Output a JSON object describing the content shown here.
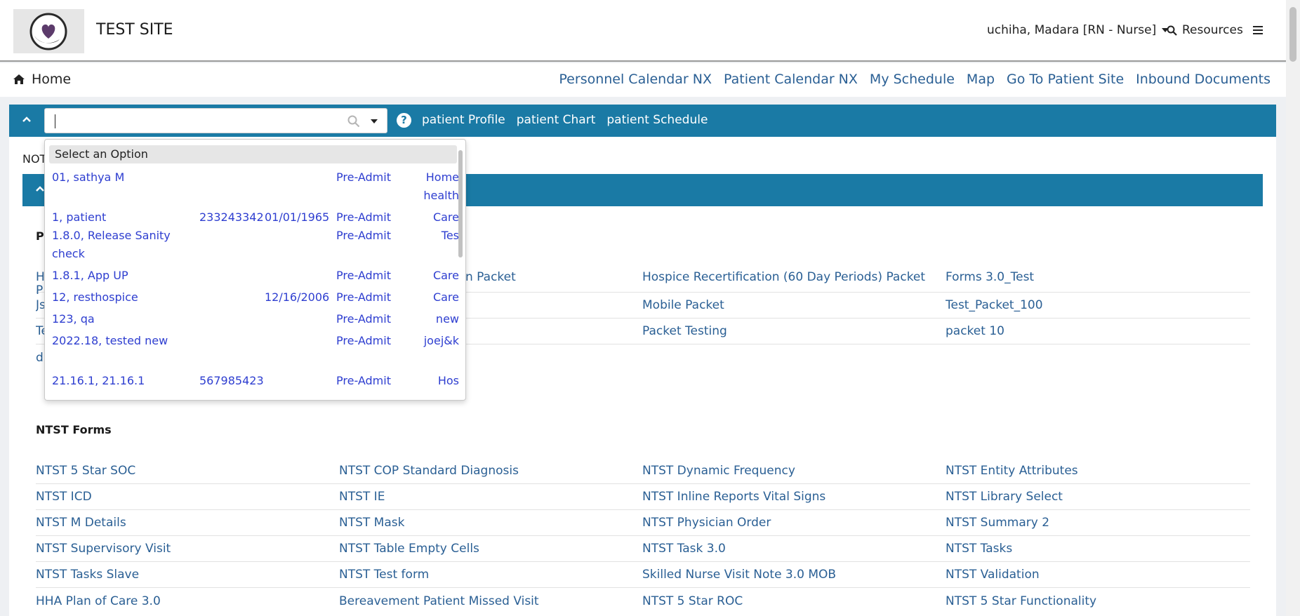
{
  "header": {
    "site_title": "TEST SITE",
    "user_label": "uchiha, Madara [RN - Nurse]",
    "resources_label": "Resources"
  },
  "nav": {
    "home_label": "Home",
    "links": [
      "Personnel Calendar NX",
      "Patient Calendar NX",
      "My Schedule",
      "Map",
      "Go To Patient Site",
      "Inbound Documents"
    ]
  },
  "patient_bar": {
    "search_value": "",
    "links": [
      "patient Profile",
      "patient Chart",
      "patient Schedule"
    ]
  },
  "main": {
    "not_text_fragment": "NOT",
    "packets_heading_fragment": "P",
    "packet_rows": [
      [
        "H",
        "n Packet",
        "Hospice Recertification (60 Day Periods) Packet",
        "Forms 3.0_Test"
      ],
      [
        "Js",
        "",
        "Mobile Packet",
        "Test_Packet_100"
      ],
      [
        "Te",
        "",
        "Packet Testing",
        "packet 10"
      ],
      [
        "di",
        "",
        "",
        ""
      ]
    ],
    "packet_row0_second_line_fragment": "P",
    "ntst_heading": "NTST Forms",
    "ntst_rows": [
      [
        "NTST 5 Star SOC",
        "NTST COP Standard Diagnosis",
        "NTST Dynamic Frequency",
        "NTST Entity Attributes"
      ],
      [
        "NTST ICD",
        "NTST IE",
        "NTST Inline Reports Vital Signs",
        "NTST Library Select"
      ],
      [
        "NTST M Details",
        "NTST Mask",
        "NTST Physician Order",
        "NTST Summary 2"
      ],
      [
        "NTST Supervisory Visit",
        "NTST Table Empty Cells",
        "NTST Task 3.0",
        "NTST Tasks"
      ],
      [
        "NTST Tasks Slave",
        "NTST Test form",
        "Skilled Nurse Visit Note 3.0 MOB",
        "NTST Validation"
      ],
      [
        "HHA Plan of Care 3.0",
        "Bereavement Patient Missed Visit",
        "NTST 5 Star ROC",
        "NTST 5 Star Functionality"
      ]
    ]
  },
  "dropdown": {
    "placeholder_option": "Select an Option",
    "options": [
      {
        "name": "01, sathya M",
        "mrn": "",
        "dob": "",
        "status": "Pre-Admit",
        "program": "Home health"
      },
      {
        "name": "1, patient",
        "mrn": "233243342",
        "dob": "01/01/1965",
        "status": "Pre-Admit",
        "program": "Care"
      },
      {
        "name": "1.8.0, Release Sanity check",
        "mrn": "",
        "dob": "",
        "status": "Pre-Admit",
        "program": "Tes"
      },
      {
        "name": "1.8.1, App UP",
        "mrn": "",
        "dob": "",
        "status": "Pre-Admit",
        "program": "Care"
      },
      {
        "name": "12, resthospice",
        "mrn": "",
        "dob": "12/16/2006",
        "status": "Pre-Admit",
        "program": "Care"
      },
      {
        "name": "123, qa",
        "mrn": "",
        "dob": "",
        "status": "Pre-Admit",
        "program": "new"
      },
      {
        "name": "2022.18, tested new",
        "mrn": "",
        "dob": "",
        "status": "Pre-Admit",
        "program": "joej&k"
      },
      {
        "name": "21.16.1, 21.16.1",
        "mrn": "567985423",
        "dob": "",
        "status": "Pre-Admit",
        "program": "Hos"
      }
    ]
  },
  "colors": {
    "accent_bar": "#1a7aa5",
    "link": "#2a5f94",
    "dropdown_link": "#2e3ed0"
  }
}
